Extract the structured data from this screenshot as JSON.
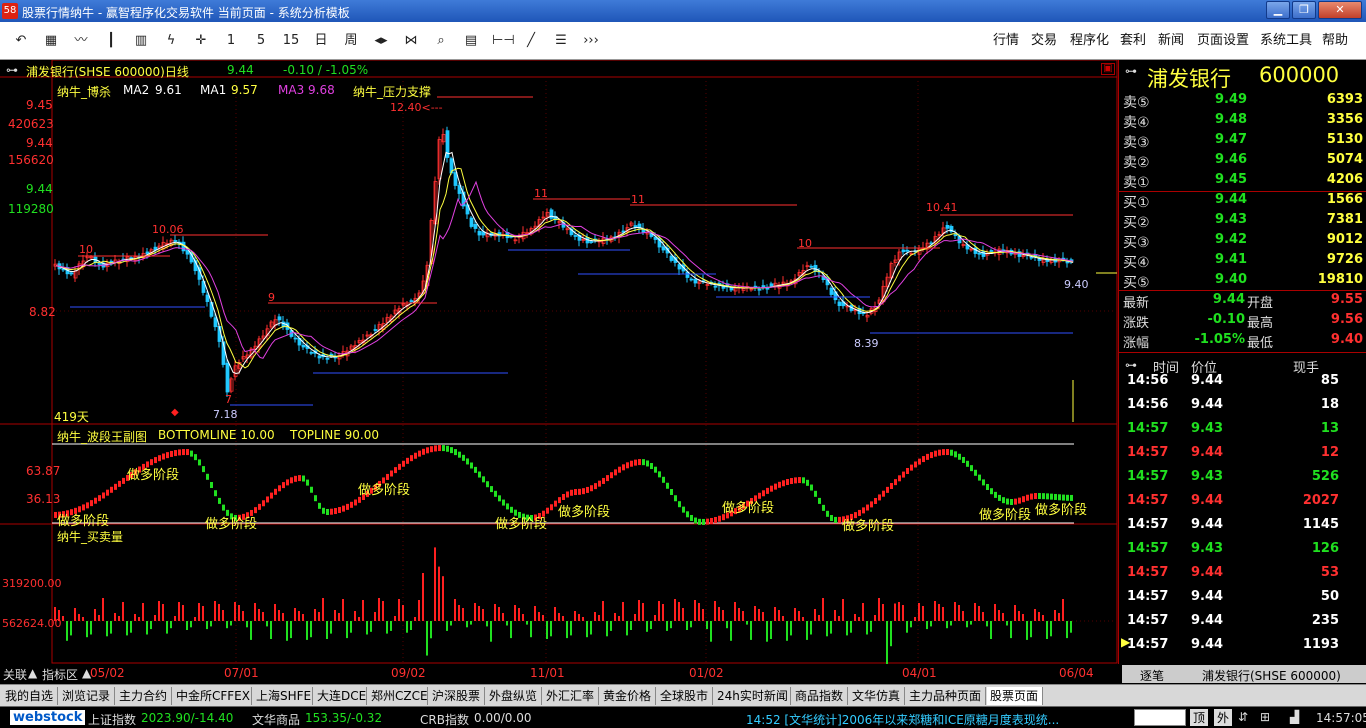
{
  "window": {
    "title": "股票行情纳牛 - 赢智程序化交易软件    当前页面 - 系统分析模板",
    "icon_text": "58"
  },
  "toolbar": {
    "icons": [
      "undo-icon",
      "grid-icon",
      "line-chart-icon",
      "candle-icon",
      "bar-chart-icon",
      "lightning-icon",
      "cursor-icon"
    ],
    "periods": [
      "1",
      "5",
      "15",
      "日",
      "周"
    ],
    "tools": [
      "left-right-icon",
      "fit-icon",
      "magnifier-icon",
      "layout-icon",
      "range-icon",
      "pen-icon",
      "list-icon",
      "more-icon"
    ],
    "menus": [
      "行情",
      "交易",
      "程序化",
      "套利",
      "新闻",
      "页面设置",
      "系统工具",
      "帮助"
    ]
  },
  "chart": {
    "header": {
      "symbol": "浦发银行(SHSE 600000)日线",
      "price": "9.44",
      "change": "-0.10 / -1.05%"
    },
    "main_legend": {
      "indicator": "纳牛_博杀",
      "ma2_label": "MA2",
      "ma2": "9.61",
      "ma1_label": "MA1",
      "ma1": "9.57",
      "ma3_label": "MA3",
      "ma3": "9.68",
      "extra": "纳牛_压力支撑"
    },
    "main_axis": [
      "9.45",
      "420623",
      "9.44",
      "156620",
      "9.44",
      "119280",
      "8.82"
    ],
    "days_label": "419天",
    "annotations": [
      "12.40<---",
      "10.06",
      "10",
      "11",
      "11",
      "10",
      "10.41",
      "9",
      "7",
      "7.18",
      "8.39",
      "9.40"
    ],
    "wave_legend": {
      "name": "纳牛_波段王副图",
      "bottom": "BOTTOMLINE  10.00",
      "top": "TOPLINE  90.00"
    },
    "wave_axis": [
      "63.87",
      "36.13"
    ],
    "wave_labels": [
      "做多阶段",
      "做多阶段",
      "做多阶段",
      "做多阶段",
      "做多阶段",
      "做多阶段",
      "做多阶段",
      "做多阶段",
      "做多阶段",
      "做多阶段"
    ],
    "vol_legend": "纳牛_买卖量",
    "vol_axis": [
      "319200.00",
      "562624.00"
    ],
    "x_labels": [
      "05/02",
      "07/01",
      "09/02",
      "11/01",
      "01/02",
      "04/01",
      "06/04"
    ]
  },
  "quote": {
    "name": "浦发银行",
    "code": "600000",
    "asks": [
      {
        "label": "卖⑤",
        "price": "9.49",
        "vol": "6393"
      },
      {
        "label": "卖④",
        "price": "9.48",
        "vol": "3356"
      },
      {
        "label": "卖③",
        "price": "9.47",
        "vol": "5130"
      },
      {
        "label": "卖②",
        "price": "9.46",
        "vol": "5074"
      },
      {
        "label": "卖①",
        "price": "9.45",
        "vol": "4206"
      }
    ],
    "bids": [
      {
        "label": "买①",
        "price": "9.44",
        "vol": "1566"
      },
      {
        "label": "买②",
        "price": "9.43",
        "vol": "7381"
      },
      {
        "label": "买③",
        "price": "9.42",
        "vol": "9012"
      },
      {
        "label": "买④",
        "price": "9.41",
        "vol": "9726"
      },
      {
        "label": "买⑤",
        "price": "9.40",
        "vol": "19810"
      }
    ],
    "stats": [
      {
        "l1": "最新",
        "v1": "9.44",
        "l2": "开盘",
        "v2": "9.55"
      },
      {
        "l1": "涨跌",
        "v1": "-0.10",
        "l2": "最高",
        "v2": "9.56"
      },
      {
        "l1": "涨幅",
        "v1": "-1.05%",
        "l2": "最低",
        "v2": "9.40"
      }
    ],
    "tick_headers": {
      "time": "时间",
      "price": "价位",
      "vol": "现手"
    },
    "ticks": [
      {
        "time": "14:56",
        "price": "9.44",
        "vol": "85",
        "c": "w"
      },
      {
        "time": "14:56",
        "price": "9.44",
        "vol": "18",
        "c": "w"
      },
      {
        "time": "14:57",
        "price": "9.43",
        "vol": "13",
        "c": "g"
      },
      {
        "time": "14:57",
        "price": "9.44",
        "vol": "12",
        "c": "r"
      },
      {
        "time": "14:57",
        "price": "9.43",
        "vol": "526",
        "c": "g"
      },
      {
        "time": "14:57",
        "price": "9.44",
        "vol": "2027",
        "c": "r"
      },
      {
        "time": "14:57",
        "price": "9.44",
        "vol": "1145",
        "c": "w"
      },
      {
        "time": "14:57",
        "price": "9.43",
        "vol": "126",
        "c": "g"
      },
      {
        "time": "14:57",
        "price": "9.44",
        "vol": "53",
        "c": "r"
      },
      {
        "time": "14:57",
        "price": "9.44",
        "vol": "50",
        "c": "w"
      },
      {
        "time": "14:57",
        "price": "9.44",
        "vol": "235",
        "c": "w"
      },
      {
        "time": "14:57",
        "price": "9.44",
        "vol": "1193",
        "c": "w"
      }
    ],
    "footer_left": "逐笔",
    "footer_right": "浦发银行(SHSE 600000)"
  },
  "subbar": {
    "left1": "关联",
    "left2": "指标区"
  },
  "tabs": [
    "我的自选",
    "浏览记录",
    "主力合约",
    "中金所CFFEX",
    "上海SHFE",
    "大连DCE",
    "郑州CZCE",
    "沪深股票",
    "外盘纵览",
    "外汇汇率",
    "黄金价格",
    "全球股市",
    "24h实时新闻",
    "商品指数",
    "文华仿真",
    "主力品种页面",
    "股票页面"
  ],
  "status": {
    "logo": "webstock",
    "idx1_name": "上证指数",
    "idx1_val": "2023.90/-14.40",
    "idx2_name": "文华商品",
    "idx2_val": "153.35/-0.32",
    "idx3_name": "CRB指数",
    "idx3_val": "0.00/0.00",
    "news": "14:52 [文华统计]2006年以来郑糖和ICE原糖月度表现统...",
    "btn_up": "顶",
    "btn_ext": "外",
    "clock": "14:57:05"
  },
  "colors": {
    "up": "#ff3030",
    "down": "#20e020",
    "bg": "#000000",
    "axis": "#aa0000",
    "yellow": "#ffff40"
  }
}
